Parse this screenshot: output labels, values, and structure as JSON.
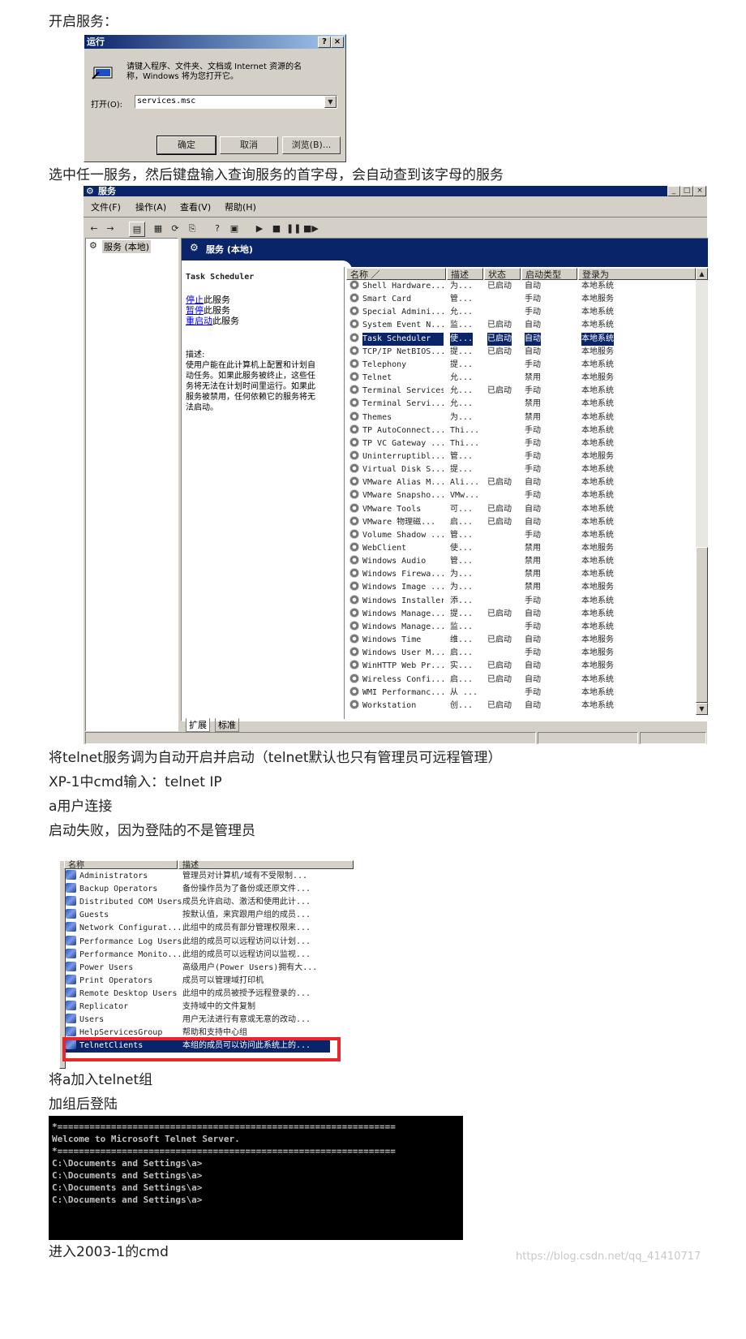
{
  "paragraphs": {
    "p1": "开启服务：",
    "p2": "选中任一服务，然后键盘输入查询服务的首字母，会自动查到该字母的服务",
    "p3": "将telnet服务调为自动开启并启动（telnet默认也只有管理员可远程管理）",
    "p4": "XP-1中cmd输入：telnet IP",
    "p5": "a用户连接",
    "p6": "启动失败，因为登陆的不是管理员",
    "p7": "将a加入telnet组",
    "p8": "加组后登陆",
    "p9": "进入2003-1的cmd"
  },
  "run_dialog": {
    "title": "运行",
    "help_btn": "?",
    "close_btn": "×",
    "prompt_line1": "请键入程序、文件夹、文档或 Internet 资源的名",
    "prompt_line2": "称，Windows 将为您打开它。",
    "open_label": "打开(O):",
    "open_value": "services.msc",
    "ok": "确定",
    "cancel": "取消",
    "browse": "浏览(B)..."
  },
  "services_window": {
    "title": "服务",
    "menu": [
      "文件(F)",
      "操作(A)",
      "查看(V)",
      "帮助(H)"
    ],
    "tree_item": "服务 (本地)",
    "banner_title": "服务 (本地)",
    "selected_name": "Task Scheduler",
    "action_stop": "停止",
    "action_stop_suffix": "此服务",
    "action_pause": "暂停",
    "action_pause_suffix": "此服务",
    "action_restart": "重启动",
    "action_restart_suffix": "此服务",
    "desc_label": "描述:",
    "desc_lines": [
      "使用户能在此计算机上配置和计划自",
      "动任务。如果此服务被终止，这些任",
      "务将无法在计划时间里运行。如果此",
      "服务被禁用，任何依赖它的服务将无",
      "法启动。"
    ],
    "columns": [
      "名称 ／",
      "描述",
      "状态",
      "启动类型",
      "登录为"
    ],
    "tabs": [
      "扩展",
      "标准"
    ],
    "rows": [
      [
        "Shell Hardware...",
        "为...",
        "已启动",
        "自动",
        "本地系统"
      ],
      [
        "Smart Card",
        "管...",
        "",
        "手动",
        "本地服务"
      ],
      [
        "Special Admini...",
        "允...",
        "",
        "手动",
        "本地系统"
      ],
      [
        "System Event N...",
        "监...",
        "已启动",
        "自动",
        "本地系统"
      ],
      [
        "Task Scheduler",
        "使...",
        "已启动",
        "自动",
        "本地系统"
      ],
      [
        "TCP/IP NetBIOS...",
        "提...",
        "已启动",
        "自动",
        "本地服务"
      ],
      [
        "Telephony",
        "提...",
        "",
        "手动",
        "本地系统"
      ],
      [
        "Telnet",
        "允...",
        "",
        "禁用",
        "本地服务"
      ],
      [
        "Terminal Services",
        "允...",
        "已启动",
        "手动",
        "本地系统"
      ],
      [
        "Terminal Servi...",
        "允...",
        "",
        "禁用",
        "本地系统"
      ],
      [
        "Themes",
        "为...",
        "",
        "禁用",
        "本地系统"
      ],
      [
        "TP AutoConnect...",
        "Thi...",
        "",
        "手动",
        "本地系统"
      ],
      [
        "TP VC Gateway ...",
        "Thi...",
        "",
        "手动",
        "本地系统"
      ],
      [
        "Uninterruptibl...",
        "管...",
        "",
        "手动",
        "本地服务"
      ],
      [
        "Virtual Disk S...",
        "提...",
        "",
        "手动",
        "本地系统"
      ],
      [
        "VMware Alias M...",
        "Ali...",
        "已启动",
        "自动",
        "本地系统"
      ],
      [
        "VMware Snapsho...",
        "VMw...",
        "",
        "手动",
        "本地系统"
      ],
      [
        "VMware Tools",
        "可...",
        "已启动",
        "自动",
        "本地系统"
      ],
      [
        "VMware 物理磁...",
        "启...",
        "已启动",
        "自动",
        "本地系统"
      ],
      [
        "Volume Shadow ...",
        "管...",
        "",
        "手动",
        "本地系统"
      ],
      [
        "WebClient",
        "使...",
        "",
        "禁用",
        "本地服务"
      ],
      [
        "Windows Audio",
        "管...",
        "",
        "禁用",
        "本地系统"
      ],
      [
        "Windows Firewa...",
        "为...",
        "",
        "禁用",
        "本地系统"
      ],
      [
        "Windows Image ...",
        "为...",
        "",
        "禁用",
        "本地服务"
      ],
      [
        "Windows Installer",
        "添...",
        "",
        "手动",
        "本地系统"
      ],
      [
        "Windows Manage...",
        "提...",
        "已启动",
        "自动",
        "本地系统"
      ],
      [
        "Windows Manage...",
        "监...",
        "",
        "手动",
        "本地系统"
      ],
      [
        "Windows Time",
        "维...",
        "已启动",
        "自动",
        "本地服务"
      ],
      [
        "Windows User M...",
        "启...",
        "",
        "手动",
        "本地服务"
      ],
      [
        "WinHTTP Web Pr...",
        "实...",
        "已启动",
        "自动",
        "本地服务"
      ],
      [
        "Wireless Confi...",
        "启...",
        "已启动",
        "自动",
        "本地系统"
      ],
      [
        "WMI Performanc...",
        "从 ...",
        "",
        "手动",
        "本地系统"
      ],
      [
        "Workstation",
        "创...",
        "已启动",
        "自动",
        "本地系统"
      ]
    ]
  },
  "groups_list": {
    "columns": [
      "名称",
      "描述"
    ],
    "rows": [
      [
        "Administrators",
        "管理员对计算机/域有不受限制..."
      ],
      [
        "Backup Operators",
        "备份操作员为了备份或还原文件..."
      ],
      [
        "Distributed COM Users",
        "成员允许启动、激活和使用此计..."
      ],
      [
        "Guests",
        "按默认值，来宾跟用户组的成员..."
      ],
      [
        "Network Configurat...",
        "此组中的成员有部分管理权限来..."
      ],
      [
        "Performance Log Users",
        "此组的成员可以远程访问以计划..."
      ],
      [
        "Performance Monito...",
        "此组的成员可以远程访问以监视..."
      ],
      [
        "Power Users",
        "高级用户(Power Users)拥有大..."
      ],
      [
        "Print Operators",
        "成员可以管理域打印机"
      ],
      [
        "Remote Desktop Users",
        "此组中的成员被授予远程登录的..."
      ],
      [
        "Replicator",
        "支持域中的文件复制"
      ],
      [
        "Users",
        "用户无法进行有意或无意的改动..."
      ],
      [
        "HelpServicesGroup",
        "帮助和支持中心组"
      ],
      [
        "TelnetClients",
        "本组的成员可以访问此系统上的..."
      ]
    ],
    "highlight_color": "#e8262b"
  },
  "console": {
    "lines": [
      "*===============================================================",
      "Welcome to Microsoft Telnet Server.",
      "*===============================================================",
      "C:\\Documents and Settings\\a>",
      "C:\\Documents and Settings\\a>",
      "C:\\Documents and Settings\\a>",
      "C:\\Documents and Settings\\a>"
    ]
  },
  "watermark": "https://blog.csdn.net/qq_41410717"
}
